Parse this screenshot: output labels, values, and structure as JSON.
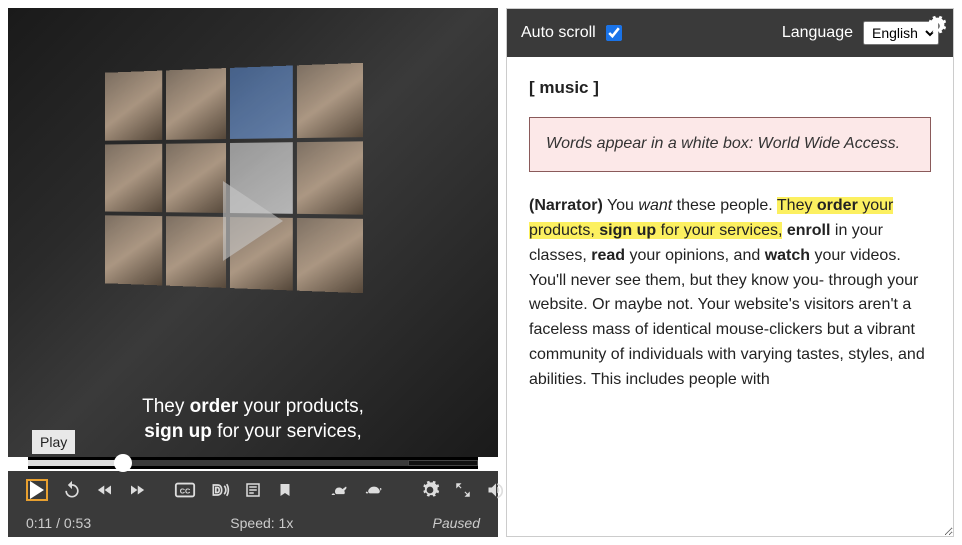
{
  "player": {
    "tooltip_play": "Play",
    "caption_line1_pre": "They ",
    "caption_line1_b": "order",
    "caption_line1_post": " your products,",
    "caption_line2_b": "sign up",
    "caption_line2_post": " for your services,",
    "time": "0:11 / 0:53",
    "speed": "Speed: 1x",
    "status": "Paused"
  },
  "transcript": {
    "autoscroll_label": "Auto scroll",
    "autoscroll_checked": true,
    "language_label": "Language",
    "language_value": "English",
    "music_marker": "[ music ]",
    "description_box": "Words appear in a white box: World Wide Access.",
    "seg_narrator": "(Narrator)",
    "seg_you": " You ",
    "seg_want": "want",
    "seg_these": " these people. ",
    "seg_hl1_pre": "They ",
    "seg_hl1_b": "order",
    "seg_hl1_post": " your products, ",
    "seg_hl2_b": "sign up",
    "seg_hl2_post": " for your services,",
    "seg_rest1": " ",
    "seg_enroll": "enroll",
    "seg_rest2": " in your classes, ",
    "seg_read": "read",
    "seg_rest3": " your opinions, and ",
    "seg_watch": "watch",
    "seg_rest4": " your videos. You'll never see them, but they know you- through your website. Or maybe not. Your website's visitors aren't a faceless mass of identical mouse-clickers but a vibrant community of individuals with varying tastes, styles, and abilities. This includes people with"
  }
}
